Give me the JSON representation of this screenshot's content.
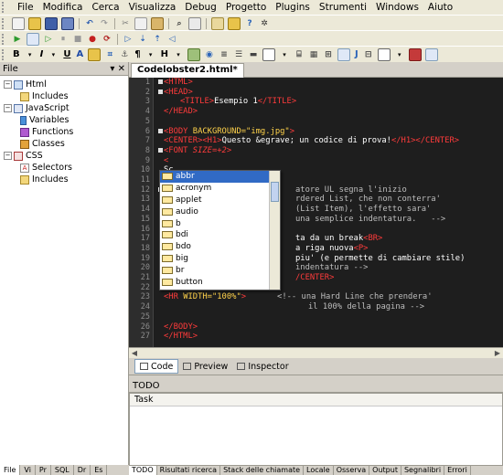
{
  "menu": [
    "File",
    "Modifica",
    "Cerca",
    "Visualizza",
    "Debug",
    "Progetto",
    "Plugins",
    "Strumenti",
    "Windows",
    "Aiuto"
  ],
  "toolbar_text": {
    "bold": "B",
    "italic": "I",
    "underline": "U",
    "font": "A",
    "para": "¶",
    "header": "H"
  },
  "left_panel": {
    "title": "File",
    "controls": "▾ ✕",
    "tree": [
      {
        "label": "Html",
        "level": 0,
        "toggle": "−",
        "icon": "html-icon"
      },
      {
        "label": "Includes",
        "level": 1,
        "toggle": "",
        "icon": "folder-icon"
      },
      {
        "label": "JavaScript",
        "level": 0,
        "toggle": "−",
        "icon": "javascript-icon"
      },
      {
        "label": "Variables",
        "level": 1,
        "toggle": "",
        "icon": "variable-icon"
      },
      {
        "label": "Functions",
        "level": 1,
        "toggle": "",
        "icon": "function-icon"
      },
      {
        "label": "Classes",
        "level": 1,
        "toggle": "",
        "icon": "class-icon"
      },
      {
        "label": "CSS",
        "level": 0,
        "toggle": "−",
        "icon": "css-icon"
      },
      {
        "label": "Selectors",
        "level": 1,
        "toggle": "",
        "icon": "selector-icon"
      },
      {
        "label": "Includes",
        "level": 1,
        "toggle": "",
        "icon": "folder-icon"
      }
    ],
    "bottom_tabs": [
      "File",
      "Vi",
      "Pr",
      "SQL",
      "Dr",
      "Es"
    ]
  },
  "document_tab": "Codelobster2.html*",
  "editor": {
    "line_numbers": [
      1,
      2,
      3,
      4,
      5,
      6,
      7,
      8,
      9,
      10,
      11,
      12,
      13,
      14,
      15,
      16,
      17,
      18,
      19,
      20,
      21,
      22,
      23,
      24,
      25,
      26,
      27
    ],
    "lines": {
      "l1": "<HTML>",
      "l2": "<HEAD>",
      "l3a": "<TITLE>",
      "l3b": "Esempio 1",
      "l3c": "</TITLE>",
      "l4": "</HEAD>",
      "l6a": "<BODY ",
      "l6b": "BACKGROUND=\"img.jpg\"",
      "l6c": ">",
      "l7a": "<CENTER><H1>",
      "l7b": "Questo &egrave; un codice di prova!",
      "l7c": "</H1></CENTER>",
      "l8a": "<FONT ",
      "l8b": "SIZE=+2",
      "l8c": ">",
      "l9": "<",
      "l10": "Sc",
      "l12": "atore UL segna l'inizio",
      "l13": "rdered List, che non conterra'",
      "l14": "(List Item), l'effetto sara'",
      "l15": "una semplice indentatura.   -->",
      "l17a": "ta da un break",
      "l17b": "<BR>",
      "l18a": "a riga nuova",
      "l18b": "<P>",
      "l19": "piu' (e permette di cambiare stile)",
      "l20": "indentatura -->",
      "l21": "/CENTER>",
      "l22": "</FONT>",
      "l23a": "<HR ",
      "l23b": "WIDTH=\"100%\"",
      "l23c": ">",
      "l23d": "<!-- una Hard Line che prendera'",
      "l24": "il 100% della pagina -->",
      "l26": "</BODY>",
      "l27": "</HTML>",
      "l20pre": "</",
      "l21pre": "</",
      "l12pre": "<"
    }
  },
  "autocomplete": [
    "abbr",
    "acronym",
    "applet",
    "audio",
    "b",
    "bdi",
    "bdo",
    "big",
    "br",
    "button"
  ],
  "view_tabs": [
    "Code",
    "Preview",
    "Inspector"
  ],
  "todo": {
    "title": "TODO",
    "column": "Task"
  },
  "bottom_tabs_right": [
    "TODO",
    "Risultati ricerca",
    "Stack delle chiamate",
    "Locale",
    "Osserva",
    "Output",
    "Segnalibri",
    "Errori"
  ]
}
